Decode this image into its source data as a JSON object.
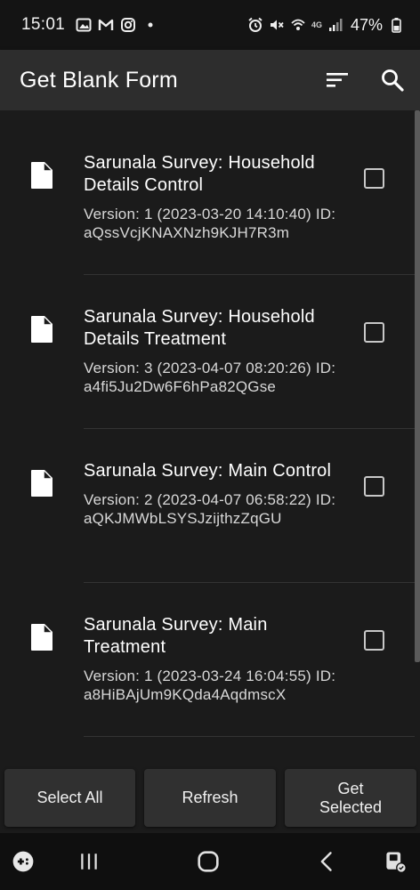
{
  "status_bar": {
    "time": "15:01",
    "battery_text": "47%",
    "network_label": "4G",
    "notification_icons": [
      "gallery-icon",
      "gmail-icon",
      "instagram-icon",
      "dot-icon"
    ],
    "system_icons": [
      "alarm-icon",
      "mute-icon",
      "wifi-call-icon",
      "signal-icon",
      "battery-icon"
    ]
  },
  "app_bar": {
    "title": "Get Blank Form",
    "actions": [
      "sort-icon",
      "search-icon"
    ]
  },
  "forms": [
    {
      "title": "Sarunala Survey: Household Details Control",
      "meta": "Version: 1 (2023-03-20 14:10:40) ID: aQssVcjKNAXNzh9KJH7R3m",
      "checked": false
    },
    {
      "title": "Sarunala Survey: Household Details Treatment",
      "meta": "Version: 3 (2023-04-07 08:20:26) ID: a4fi5Ju2Dw6F6hPa82QGse",
      "checked": false
    },
    {
      "title": "Sarunala Survey: Main Control",
      "meta": "Version: 2 (2023-04-07 06:58:22) ID: aQKJMWbLSYSJzijthzZqGU",
      "checked": false
    },
    {
      "title": "Sarunala Survey: Main Treatment",
      "meta": "Version: 1 (2023-03-24 16:04:55) ID: a8HiBAjUm9KQda4AqdmscX",
      "checked": false
    }
  ],
  "buttons": {
    "select_all": "Select All",
    "refresh": "Refresh",
    "get_selected": "Get Selected"
  },
  "colors": {
    "background": "#1b1b1b",
    "app_bar": "#2d2d2d",
    "button": "#303030",
    "text": "#ffffff"
  }
}
